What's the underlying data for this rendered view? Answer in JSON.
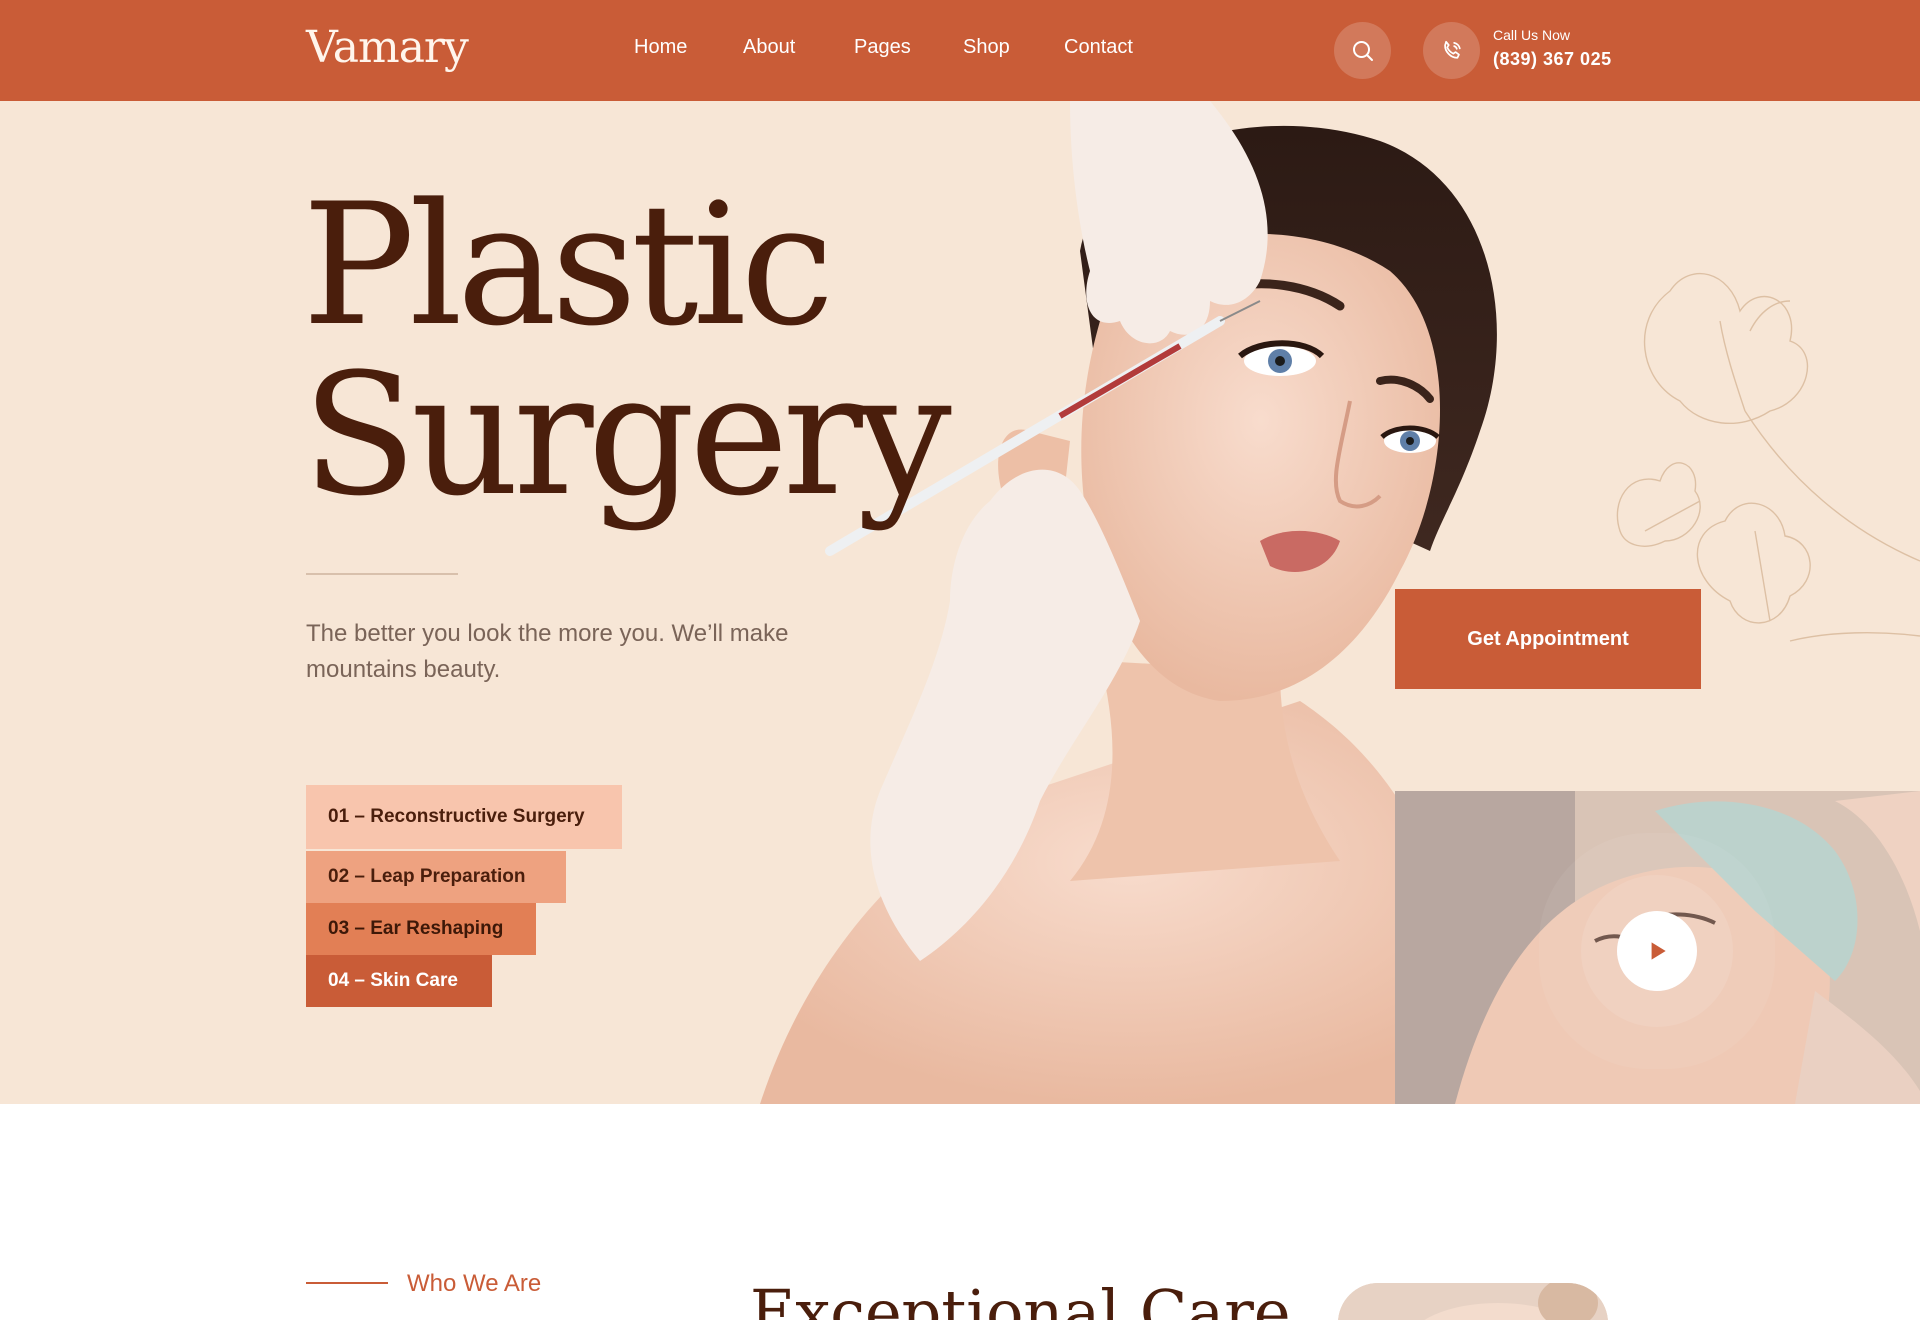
{
  "header": {
    "logo": "Vamary",
    "nav": [
      {
        "label": "Home"
      },
      {
        "label": "About"
      },
      {
        "label": "Pages"
      },
      {
        "label": "Shop"
      },
      {
        "label": "Contact"
      }
    ],
    "call_label": "Call Us Now",
    "call_number": "(839) 367 025",
    "icons": [
      "search-icon",
      "phone-icon"
    ]
  },
  "hero": {
    "title_line1": "Plastic",
    "title_line2": "Surgery",
    "tagline": "The better you look the more you. We’ll make mountains beauty.",
    "services": [
      {
        "label": "01 – Reconstructive Surgery"
      },
      {
        "label": "02 – Leap Preparation"
      },
      {
        "label": "03 – Ear Reshaping"
      },
      {
        "label": "04 – Skin Care"
      }
    ],
    "appointment_label": "Get Appointment",
    "play_icon": "play-icon"
  },
  "about": {
    "label": "Who We Are",
    "heading": "Exceptional Care"
  },
  "colors": {
    "brand": "#c95c37",
    "hero_bg": "#f7e6d6",
    "title": "#4a1e0c",
    "service_1": "#f8c5ad",
    "service_2": "#eea280",
    "service_3": "#e27f55",
    "service_4": "#c95c37"
  }
}
